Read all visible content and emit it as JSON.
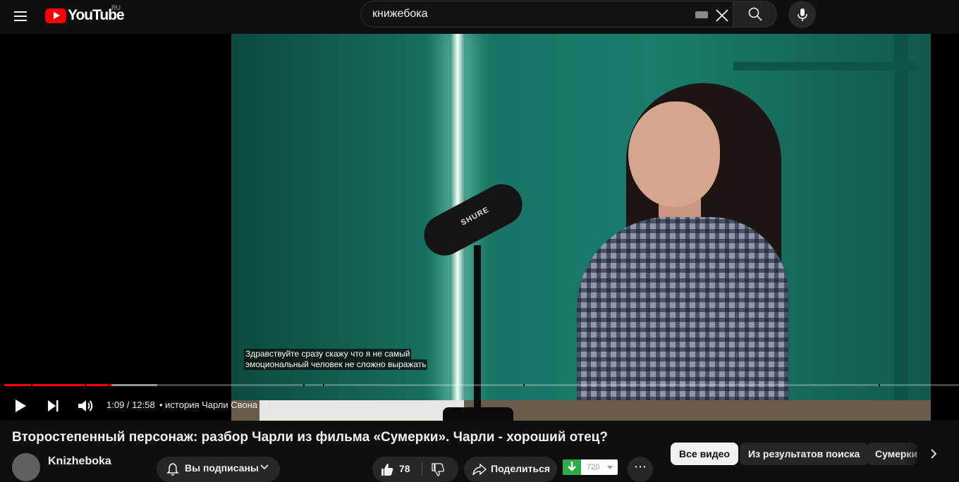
{
  "header": {
    "logo_text": "YouTube",
    "region": "RU",
    "search_value": "книжебока"
  },
  "player": {
    "subtitle_lines": [
      "Здравствуйте сразу скажу что я не самый",
      "эмоциональный человек не сложно выражать"
    ],
    "time": "1:09 / 12:58",
    "chapter": "• история Чарли Свона",
    "mic_brand": "SHURE",
    "progress_played": 0.113,
    "progress_loaded": 0.16
  },
  "video": {
    "title": "Второстепенный персонаж: разбор Чарли из фильма «Сумерки». Чарли - хороший отец?",
    "channel": "Knizheboka",
    "subscribe_label": "Вы подписаны",
    "likes": "78",
    "share_label": "Поделиться",
    "ext_count": "720"
  },
  "chips": {
    "all": "Все видео",
    "from_search": "Из результатов поиска",
    "twilight": "Сумерки"
  },
  "colors": {
    "accent": "#ff0000",
    "background": "#0f0f0f",
    "ext_green": "#2aae4a"
  }
}
